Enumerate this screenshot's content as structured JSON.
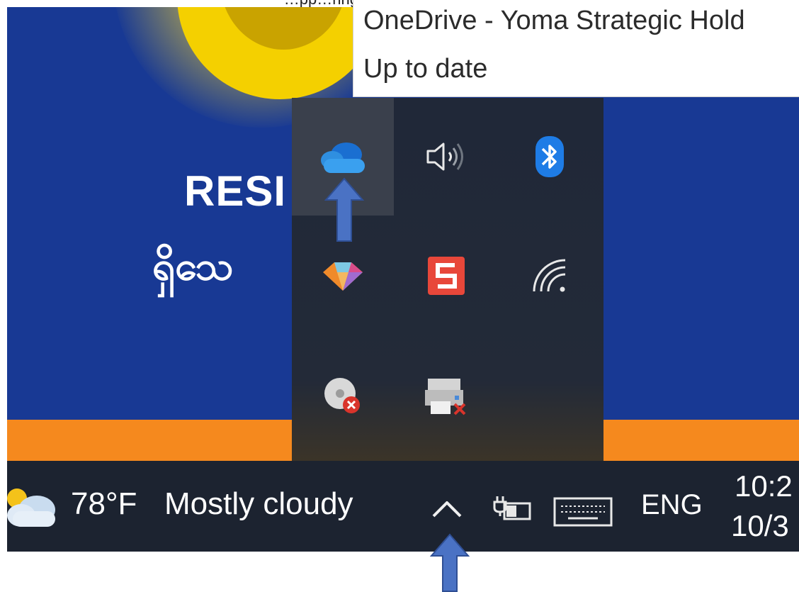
{
  "caption": "…pp…ring … … … … … … pp…",
  "wallpaper": {
    "heading": "RESI",
    "subtext": "ရှိသေ"
  },
  "tooltip": {
    "title": "OneDrive - Yoma Strategic Hold",
    "status": "Up to date"
  },
  "tray_icons": [
    {
      "name": "onedrive-icon",
      "highlighted": true,
      "color": "#2f8fe0"
    },
    {
      "name": "speaker-icon"
    },
    {
      "name": "bluetooth-icon",
      "color": "#1e7ce6"
    },
    {
      "name": "gem-app-icon"
    },
    {
      "name": "snagit-icon",
      "color": "#e8473a"
    },
    {
      "name": "wifi-icon"
    },
    {
      "name": "disconnected-disk-icon"
    },
    {
      "name": "printer-error-icon"
    }
  ],
  "taskbar": {
    "temperature": "78°F",
    "condition": "Mostly cloudy",
    "language": "ENG",
    "time": "10:2",
    "date": "10/3"
  },
  "colors": {
    "taskbar_bg": "#1c2330",
    "flyout_bg": "#202838",
    "annotation_arrow": "#4a72c4",
    "wallpaper_blue": "#183994",
    "wallpaper_orange": "#f5891e"
  }
}
